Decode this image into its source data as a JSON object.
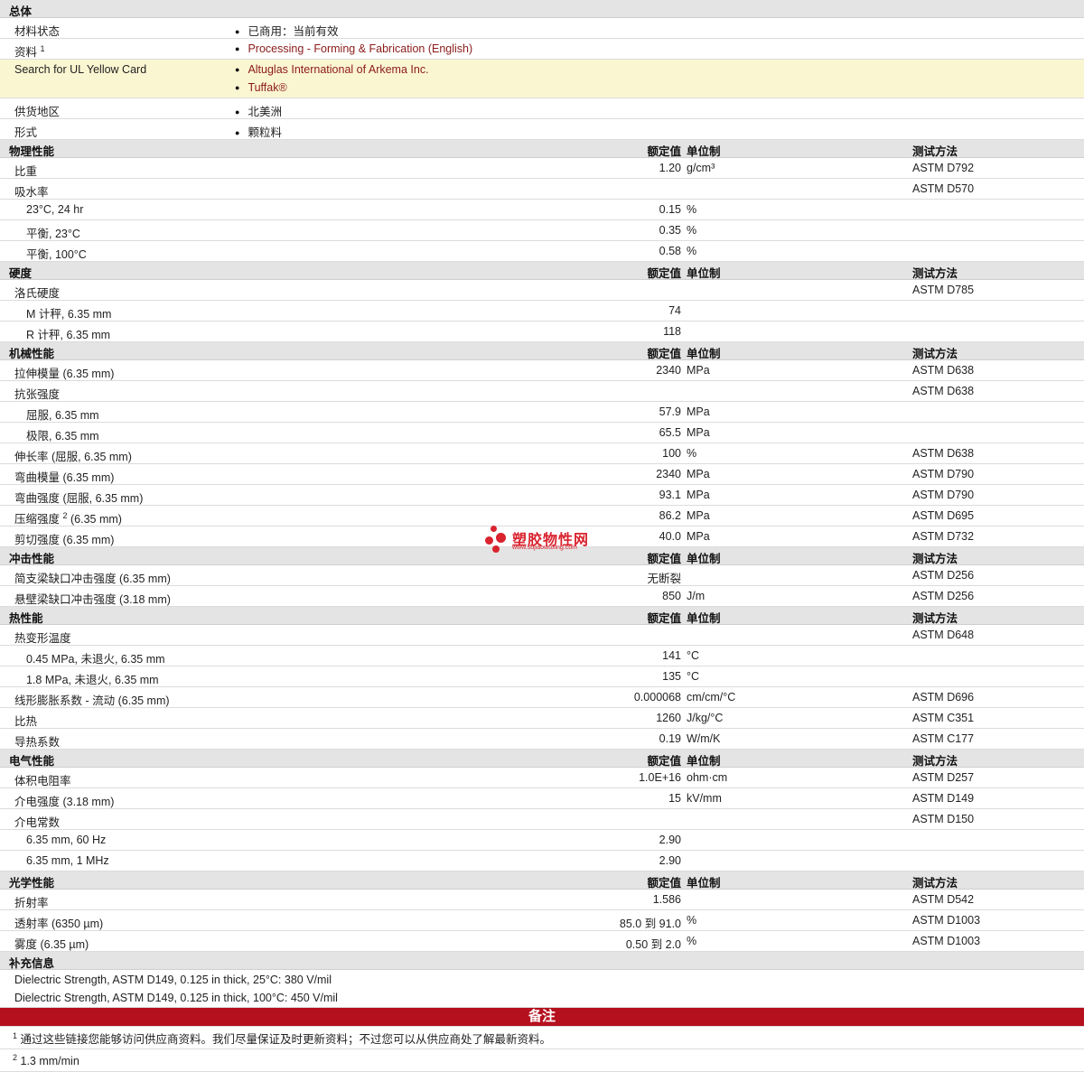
{
  "general": {
    "header": "总体",
    "rows": [
      {
        "name": "材料状态",
        "items": [
          "已商用：当前有效"
        ],
        "link": false
      },
      {
        "name": "资料",
        "sup": "1",
        "items": [
          "Processing - Forming & Fabrication (English)"
        ],
        "link": true
      },
      {
        "name": "Search for UL Yellow Card",
        "items": [
          "Altuglas International of Arkema Inc.",
          "Tuffak®"
        ],
        "link": true,
        "highlight": true
      },
      {
        "name": "供货地区",
        "items": [
          "北美洲"
        ],
        "link": false
      },
      {
        "name": "形式",
        "items": [
          "颗粒料"
        ],
        "link": false
      }
    ]
  },
  "col_labels": {
    "value": "额定值",
    "unit": "单位制",
    "method": "测试方法"
  },
  "sections": [
    {
      "title": "物理性能",
      "rows": [
        {
          "name": "比重",
          "value": "1.20",
          "unit": "g/cm³",
          "method": "ASTM D792"
        },
        {
          "name": "吸水率",
          "value": "",
          "unit": "",
          "method": "ASTM D570"
        },
        {
          "name": "23°C, 24 hr",
          "sub": true,
          "value": "0.15",
          "unit": "%",
          "method": ""
        },
        {
          "name": "平衡, 23°C",
          "sub": true,
          "value": "0.35",
          "unit": "%",
          "method": ""
        },
        {
          "name": "平衡, 100°C",
          "sub": true,
          "value": "0.58",
          "unit": "%",
          "method": ""
        }
      ]
    },
    {
      "title": "硬度",
      "rows": [
        {
          "name": "洛氏硬度",
          "value": "",
          "unit": "",
          "method": "ASTM D785"
        },
        {
          "name": "M 计秤, 6.35 mm",
          "sub": true,
          "value": "74",
          "unit": "",
          "method": ""
        },
        {
          "name": "R 计秤, 6.35 mm",
          "sub": true,
          "value": "118",
          "unit": "",
          "method": ""
        }
      ]
    },
    {
      "title": "机械性能",
      "rows": [
        {
          "name": "拉伸模量  (6.35 mm)",
          "value": "2340",
          "unit": "MPa",
          "method": "ASTM D638"
        },
        {
          "name": "抗张强度",
          "value": "",
          "unit": "",
          "method": "ASTM D638"
        },
        {
          "name": "屈服, 6.35 mm",
          "sub": true,
          "value": "57.9",
          "unit": "MPa",
          "method": ""
        },
        {
          "name": "极限, 6.35 mm",
          "sub": true,
          "value": "65.5",
          "unit": "MPa",
          "method": ""
        },
        {
          "name": "伸长率  (屈服, 6.35 mm)",
          "value": "100",
          "unit": "%",
          "method": "ASTM D638"
        },
        {
          "name": "弯曲模量  (6.35 mm)",
          "value": "2340",
          "unit": "MPa",
          "method": "ASTM D790"
        },
        {
          "name": "弯曲强度  (屈服, 6.35 mm)",
          "value": "93.1",
          "unit": "MPa",
          "method": "ASTM D790"
        },
        {
          "name": "压缩强度",
          "sup": "2",
          "name2": "(6.35 mm)",
          "value": "86.2",
          "unit": "MPa",
          "method": "ASTM D695"
        },
        {
          "name": "剪切强度  (6.35 mm)",
          "value": "40.0",
          "unit": "MPa",
          "method": "ASTM D732"
        }
      ]
    },
    {
      "title": "冲击性能",
      "rows": [
        {
          "name": "简支梁缺口冲击强度  (6.35 mm)",
          "value": "无断裂",
          "unit": "",
          "method": "ASTM D256"
        },
        {
          "name": "悬壁梁缺口冲击强度  (3.18 mm)",
          "value": "850",
          "unit": "J/m",
          "method": "ASTM D256"
        }
      ]
    },
    {
      "title": "热性能",
      "rows": [
        {
          "name": "热变形温度",
          "value": "",
          "unit": "",
          "method": "ASTM D648"
        },
        {
          "name": "0.45 MPa, 未退火, 6.35 mm",
          "sub": true,
          "value": "141",
          "unit": "°C",
          "method": ""
        },
        {
          "name": "1.8 MPa, 未退火, 6.35 mm",
          "sub": true,
          "value": "135",
          "unit": "°C",
          "method": ""
        },
        {
          "name": "线形膨胀系数  - 流动  (6.35 mm)",
          "value": "0.000068",
          "unit": "cm/cm/°C",
          "method": "ASTM D696"
        },
        {
          "name": "比热",
          "value": "1260",
          "unit": "J/kg/°C",
          "method": "ASTM C351"
        },
        {
          "name": "导热系数",
          "value": "0.19",
          "unit": "W/m/K",
          "method": "ASTM C177"
        }
      ]
    },
    {
      "title": "电气性能",
      "rows": [
        {
          "name": "体积电阻率",
          "value": "1.0E+16",
          "unit": "ohm·cm",
          "method": "ASTM D257"
        },
        {
          "name": "介电强度  (3.18 mm)",
          "value": "15",
          "unit": "kV/mm",
          "method": "ASTM D149"
        },
        {
          "name": "介电常数",
          "value": "",
          "unit": "",
          "method": "ASTM D150"
        },
        {
          "name": "6.35 mm, 60 Hz",
          "sub": true,
          "value": "2.90",
          "unit": "",
          "method": ""
        },
        {
          "name": "6.35 mm, 1 MHz",
          "sub": true,
          "value": "2.90",
          "unit": "",
          "method": ""
        }
      ]
    },
    {
      "title": "光学性能",
      "rows": [
        {
          "name": "折射率",
          "value": "1.586",
          "unit": "",
          "method": "ASTM D542"
        },
        {
          "name": "透射率  (6350 µm)",
          "value": "85.0 到  91.0",
          "unit": "%",
          "method": "ASTM D1003"
        },
        {
          "name": "雾度  (6.35 µm)",
          "value": "0.50 到  2.0",
          "unit": "%",
          "method": "ASTM D1003"
        }
      ]
    }
  ],
  "supplement": {
    "title": "补充信息",
    "lines": [
      "Dielectric Strength, ASTM D149, 0.125 in thick, 25°C: 380 V/mil",
      "Dielectric Strength, ASTM D149, 0.125 in thick, 100°C: 450 V/mil"
    ]
  },
  "notes": {
    "title": "备注",
    "items": [
      {
        "num": "1",
        "text": "通过这些链接您能够访问供应商资料。我们尽量保证及时更新资料；不过您可以从供应商处了解最新资料。"
      },
      {
        "num": "2",
        "text": "1.3 mm/min"
      }
    ]
  },
  "watermark": {
    "text": "塑胶物性网",
    "url": "www.sujiaowuxing.com",
    "color": "#d9232e"
  }
}
